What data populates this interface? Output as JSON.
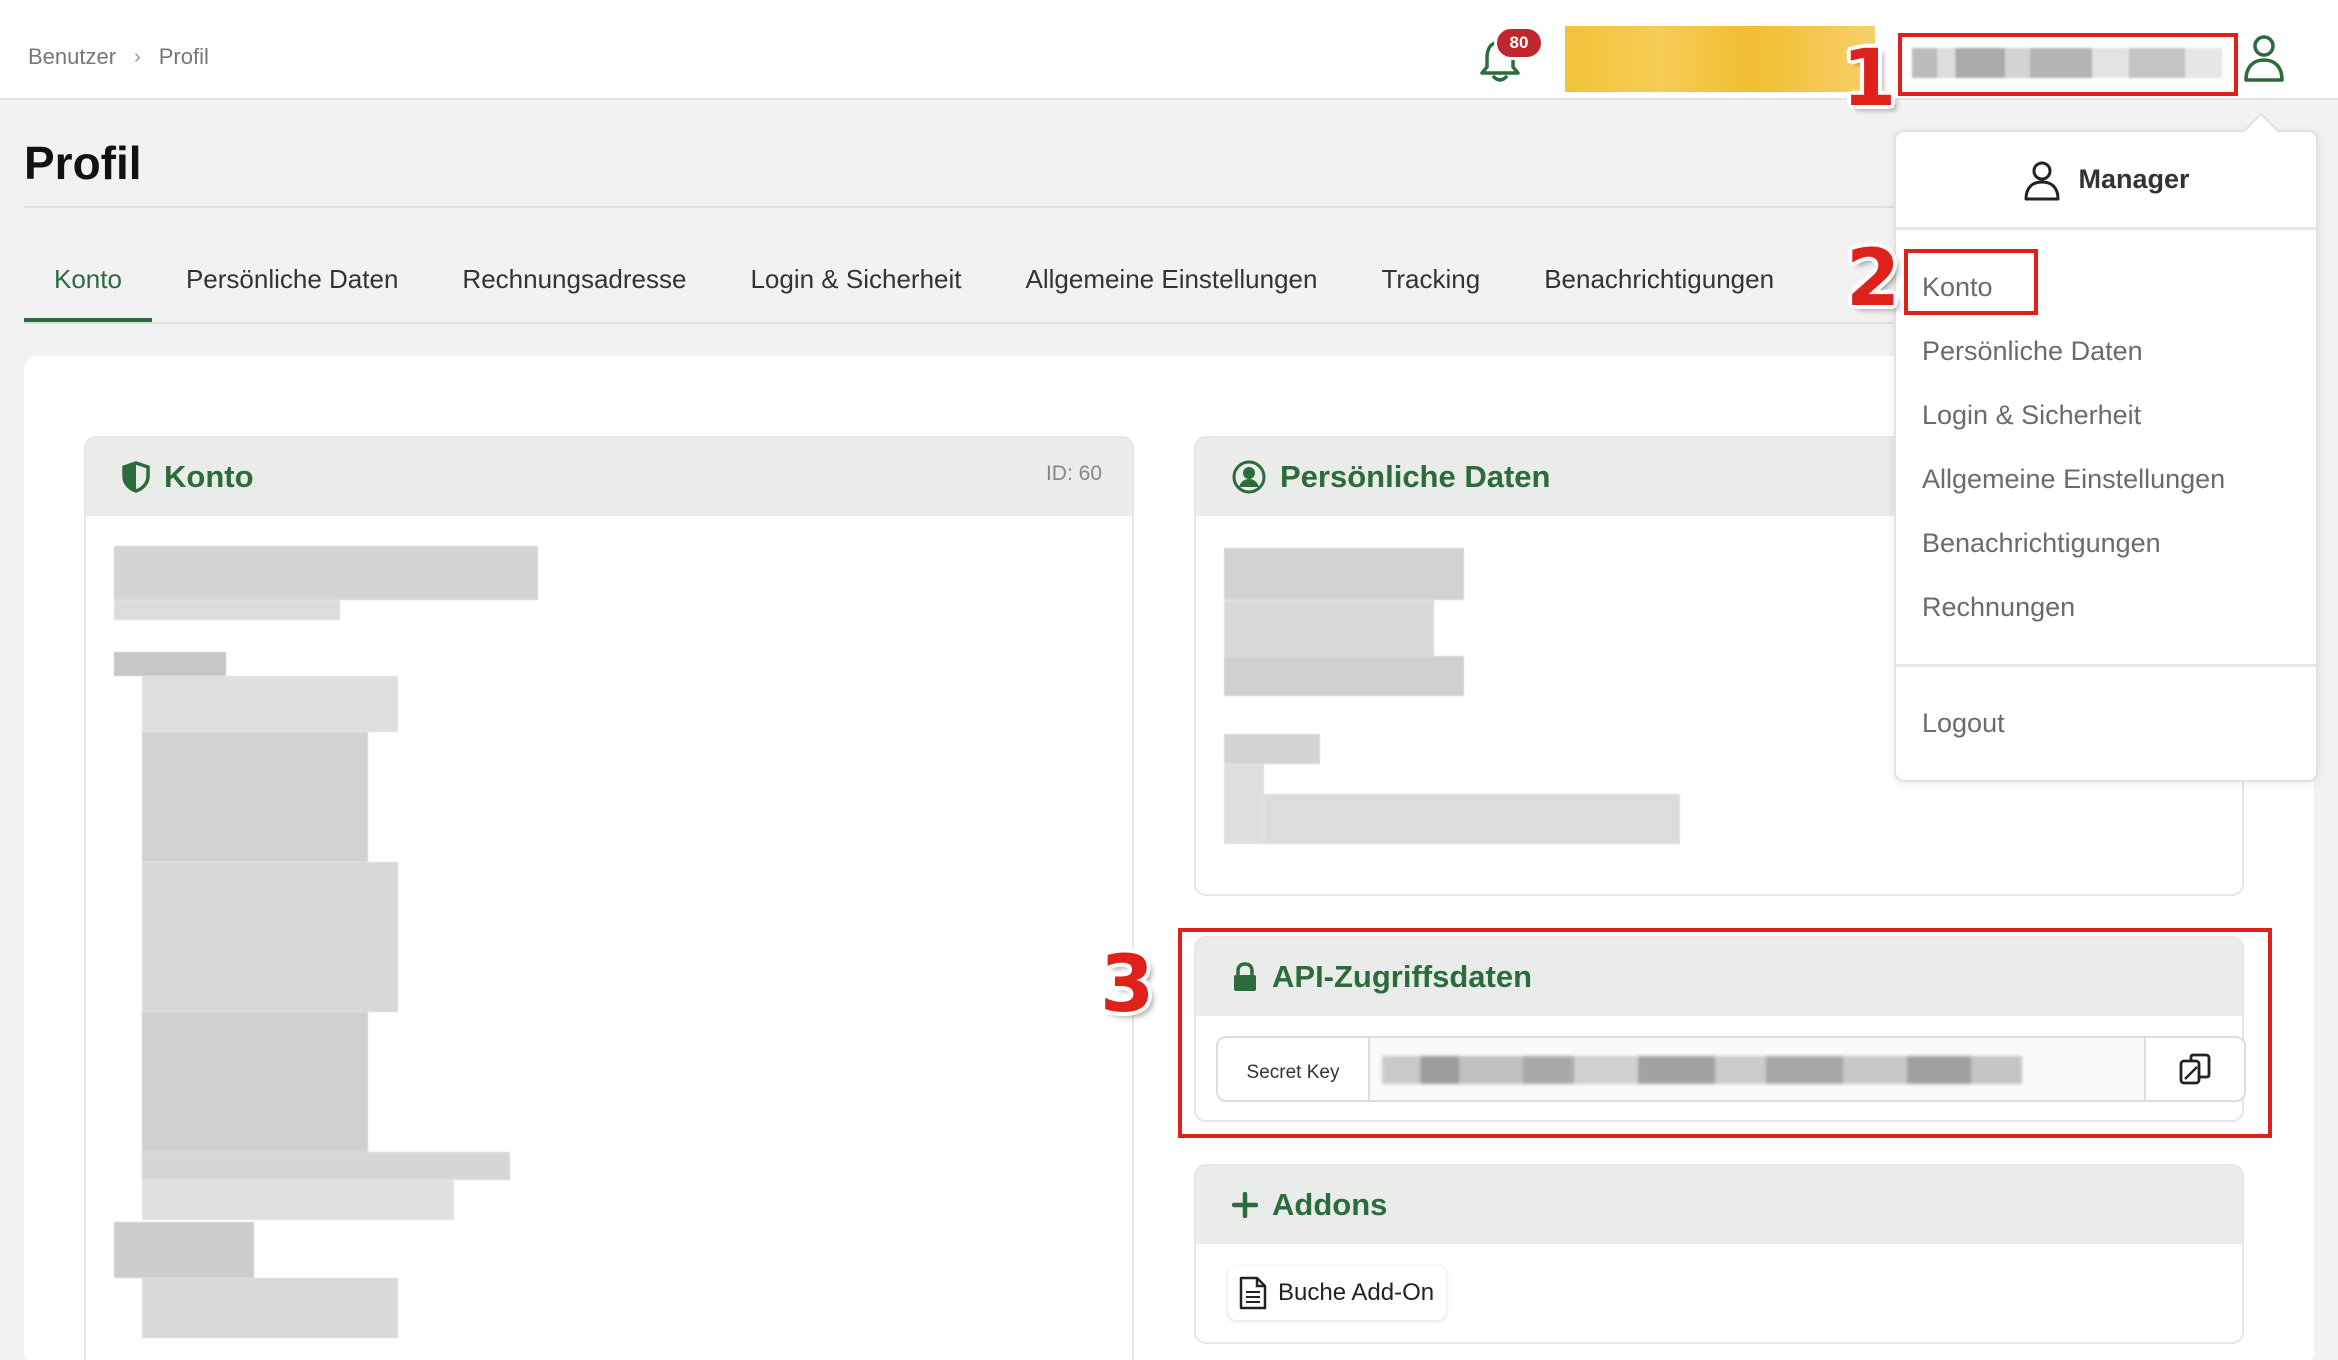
{
  "topbar": {
    "breadcrumb": [
      "Benutzer",
      "Profil"
    ],
    "breadcrumb_sep": "›",
    "notification_count": "80"
  },
  "page": {
    "title": "Profil",
    "tabs": [
      {
        "label": "Konto",
        "active": true
      },
      {
        "label": "Persönliche Daten"
      },
      {
        "label": "Rechnungsadresse"
      },
      {
        "label": "Login & Sicherheit"
      },
      {
        "label": "Allgemeine Einstellungen"
      },
      {
        "label": "Tracking"
      },
      {
        "label": "Benachrichtigungen"
      }
    ]
  },
  "cards": {
    "konto": {
      "title": "Konto",
      "id": "ID: 60",
      "icon": "shield-icon"
    },
    "personal": {
      "title": "Persönliche Daten",
      "icon": "user-circle-icon"
    },
    "api": {
      "title": "API-Zugriffsdaten",
      "icon": "lock-icon",
      "secret_label": "Secret Key",
      "copy_icon": "copy-icon"
    },
    "addons": {
      "title": "Addons",
      "icon": "plus-icon",
      "button_label": "Buche Add-On"
    }
  },
  "dropdown": {
    "role": "Manager",
    "items": [
      "Konto",
      "Persönliche Daten",
      "Login & Sicherheit",
      "Allgemeine Einstellungen",
      "Benachrichtigungen",
      "Rechnungen"
    ],
    "logout": "Logout"
  },
  "annotations": [
    "1",
    "2",
    "3"
  ],
  "colors": {
    "accent": "#2c6b3c",
    "annotation_red": "#e0201b",
    "badge_red": "#c0262d",
    "highlight_yellow": "#f3c23a"
  }
}
